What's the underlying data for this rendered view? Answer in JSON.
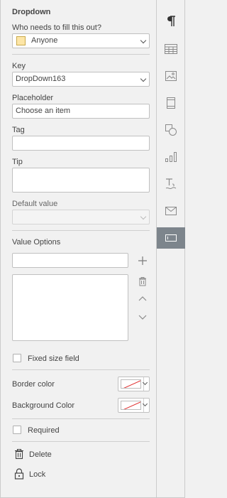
{
  "panel": {
    "title": "Dropdown",
    "who_label": "Who needs to fill this out?",
    "who_value": "Anyone",
    "who_color": "#fde6a7",
    "key_label": "Key",
    "key_value": "DropDown163",
    "placeholder_label": "Placeholder",
    "placeholder_value": "Choose an item",
    "tag_label": "Tag",
    "tag_value": "",
    "tip_label": "Tip",
    "tip_value": "",
    "default_label": "Default value",
    "default_value": "",
    "value_options_label": "Value Options",
    "value_option_input": "",
    "value_options_list": [],
    "fixed_size_label": "Fixed size field",
    "fixed_size_checked": false,
    "border_color_label": "Border color",
    "background_color_label": "Background Color",
    "required_label": "Required",
    "required_checked": false,
    "delete_label": "Delete",
    "lock_label": "Lock"
  },
  "rail": {
    "items": [
      {
        "icon": "paragraph-icon",
        "active": false
      },
      {
        "icon": "table-icon",
        "active": false
      },
      {
        "icon": "image-icon",
        "active": false
      },
      {
        "icon": "header-footer-icon",
        "active": false
      },
      {
        "icon": "shape-icon",
        "active": false
      },
      {
        "icon": "chart-icon",
        "active": false
      },
      {
        "icon": "text-art-icon",
        "active": false
      },
      {
        "icon": "mail-merge-icon",
        "active": false
      },
      {
        "icon": "form-settings-icon",
        "active": true
      }
    ]
  },
  "colors": {
    "panel_bg": "#f1f1f1",
    "active_rail": "#7d858c",
    "no_color_stroke": "#e03030"
  }
}
